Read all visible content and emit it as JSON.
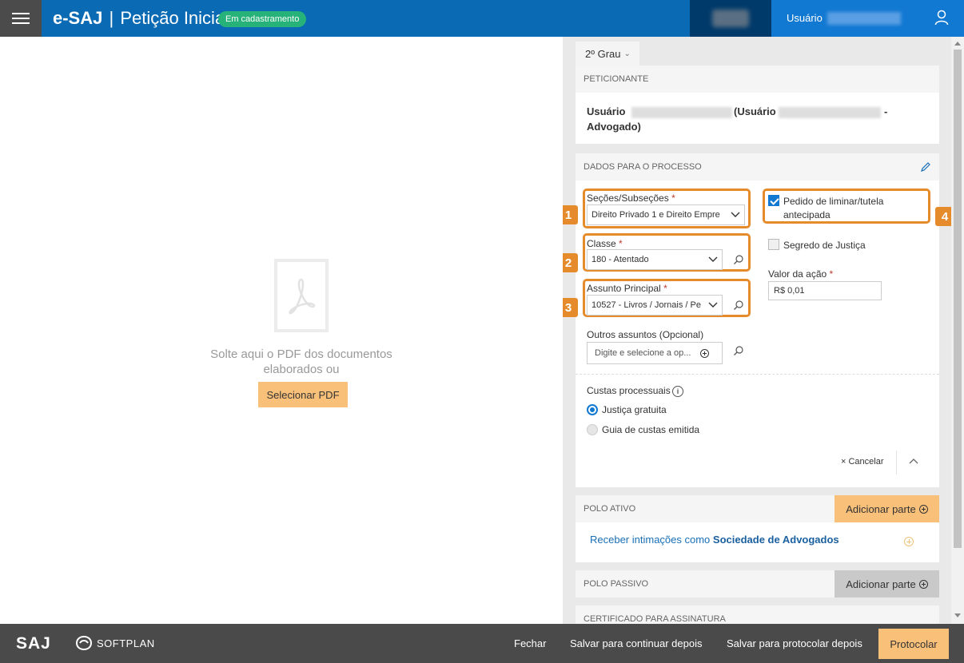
{
  "header": {
    "brand": "e-SAJ",
    "separator": "|",
    "page_title": "Petição Inicial",
    "status_badge": "Em cadastramento",
    "user_label": "Usuário"
  },
  "dropzone": {
    "instruction": "Solte aqui o PDF dos documentos elaborados ou",
    "select_button": "Selecionar PDF"
  },
  "right_panel": {
    "grau_tab": "2º Grau",
    "peticionante": {
      "header": "PETICIONANTE",
      "name_prefix": "Usuário",
      "name_middle": "(Usuário",
      "name_suffix": "-",
      "role": "Advogado)"
    },
    "dados": {
      "header": "DADOS PARA O PROCESSO",
      "secoes": {
        "label": "Seções/Subseções",
        "required": "*",
        "value": "Direito Privado 1 e Direito Empre",
        "badge": "1"
      },
      "classe": {
        "label": "Classe",
        "required": "*",
        "value": "180 - Atentado",
        "badge": "2"
      },
      "assunto": {
        "label": "Assunto Principal",
        "required": "*",
        "value": "10527 - Livros / Jornais / Pe",
        "badge": "3"
      },
      "outros": {
        "label": "Outros assuntos (Opcional)",
        "placeholder": "Digite e selecione a op..."
      },
      "liminar": {
        "label": "Pedido de liminar/tutela antecipada",
        "checked": true,
        "badge": "4"
      },
      "segredo": {
        "label": "Segredo de Justiça",
        "checked": false
      },
      "valor": {
        "label": "Valor da ação",
        "required": "*",
        "value": "R$ 0,01"
      },
      "custas": {
        "label": "Custas processuais",
        "info_icon": "i",
        "options": [
          {
            "label": "Justiça gratuita",
            "selected": true
          },
          {
            "label": "Guia de custas emitida",
            "selected": false
          }
        ]
      },
      "cancel": "× Cancelar"
    },
    "polo_ativo": {
      "header": "POLO ATIVO",
      "add_button": "Adicionar parte",
      "receber_prefix": "Receber intimações como",
      "receber_bold": "Sociedade de Advogados"
    },
    "polo_passivo": {
      "header": "POLO PASSIVO",
      "add_button": "Adicionar parte"
    },
    "certificado": {
      "header": "CERTIFICADO PARA ASSINATURA"
    }
  },
  "footer": {
    "saj_logo": "SAJ",
    "softplan": "SOFTPLAN",
    "fechar": "Fechar",
    "salvar_continuar": "Salvar para continuar depois",
    "salvar_protocolar": "Salvar para protocolar depois",
    "protocolar": "Protocolar"
  },
  "colors": {
    "header_blue": "#0a6ab4",
    "user_blue": "#1279d2",
    "status_green": "#27b27a",
    "highlight_orange": "#e58b2c",
    "action_orange": "#f9c07a",
    "footer_gray": "#4a4a4a"
  },
  "icons": [
    "menu-icon",
    "user-icon",
    "pdf-icon",
    "edit-icon",
    "chevron-down-icon",
    "search-icon",
    "plus-circle-icon",
    "info-icon",
    "chevron-up-icon",
    "softplan-logo-icon"
  ]
}
